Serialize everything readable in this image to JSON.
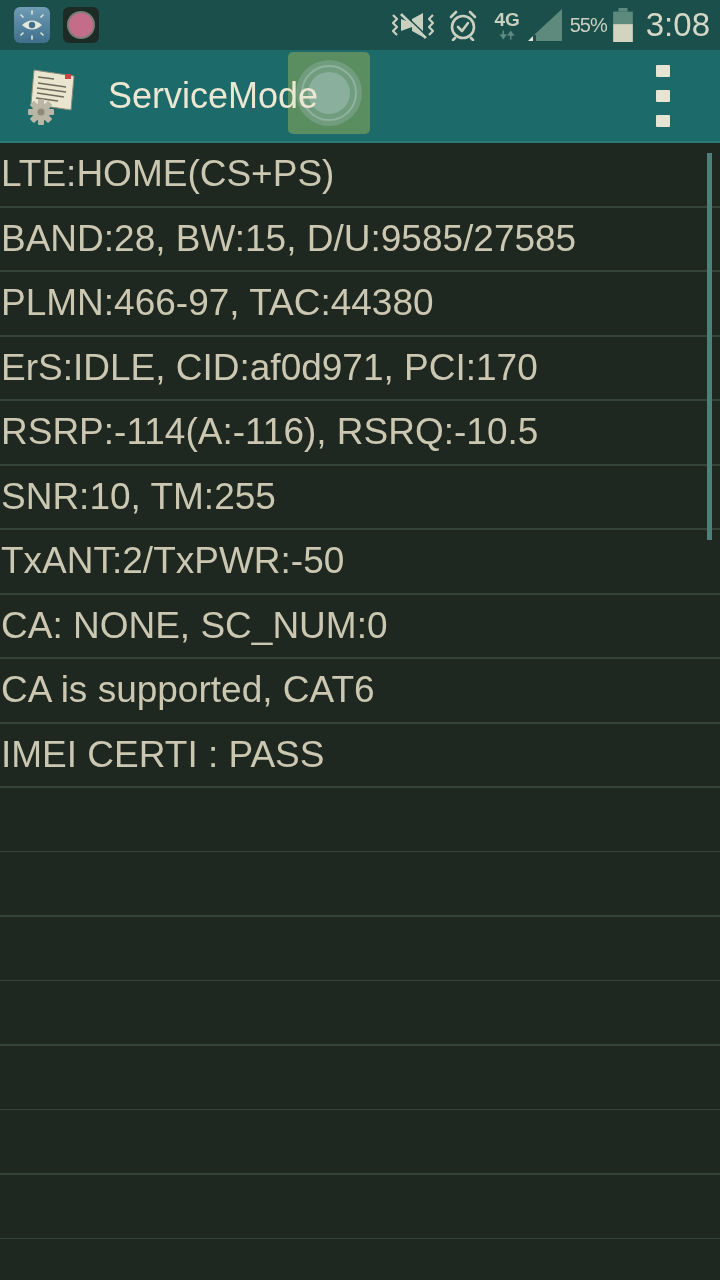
{
  "status_bar": {
    "network_type": "4G",
    "battery_text": "55%",
    "time": "3:08"
  },
  "app_bar": {
    "title": "ServiceMode"
  },
  "info_lines": [
    "LTE:HOME(CS+PS)",
    "BAND:28, BW:15, D/U:9585/27585",
    "PLMN:466-97, TAC:44380",
    "ErS:IDLE, CID:af0d971, PCI:170",
    "RSRP:-114(A:-116), RSRQ:-10.5",
    "SNR:10, TM:255",
    "TxANT:2/TxPWR:-50",
    "CA: NONE, SC_NUM:0",
    "CA is supported, CAT6",
    "IMEI CERTI : PASS"
  ]
}
